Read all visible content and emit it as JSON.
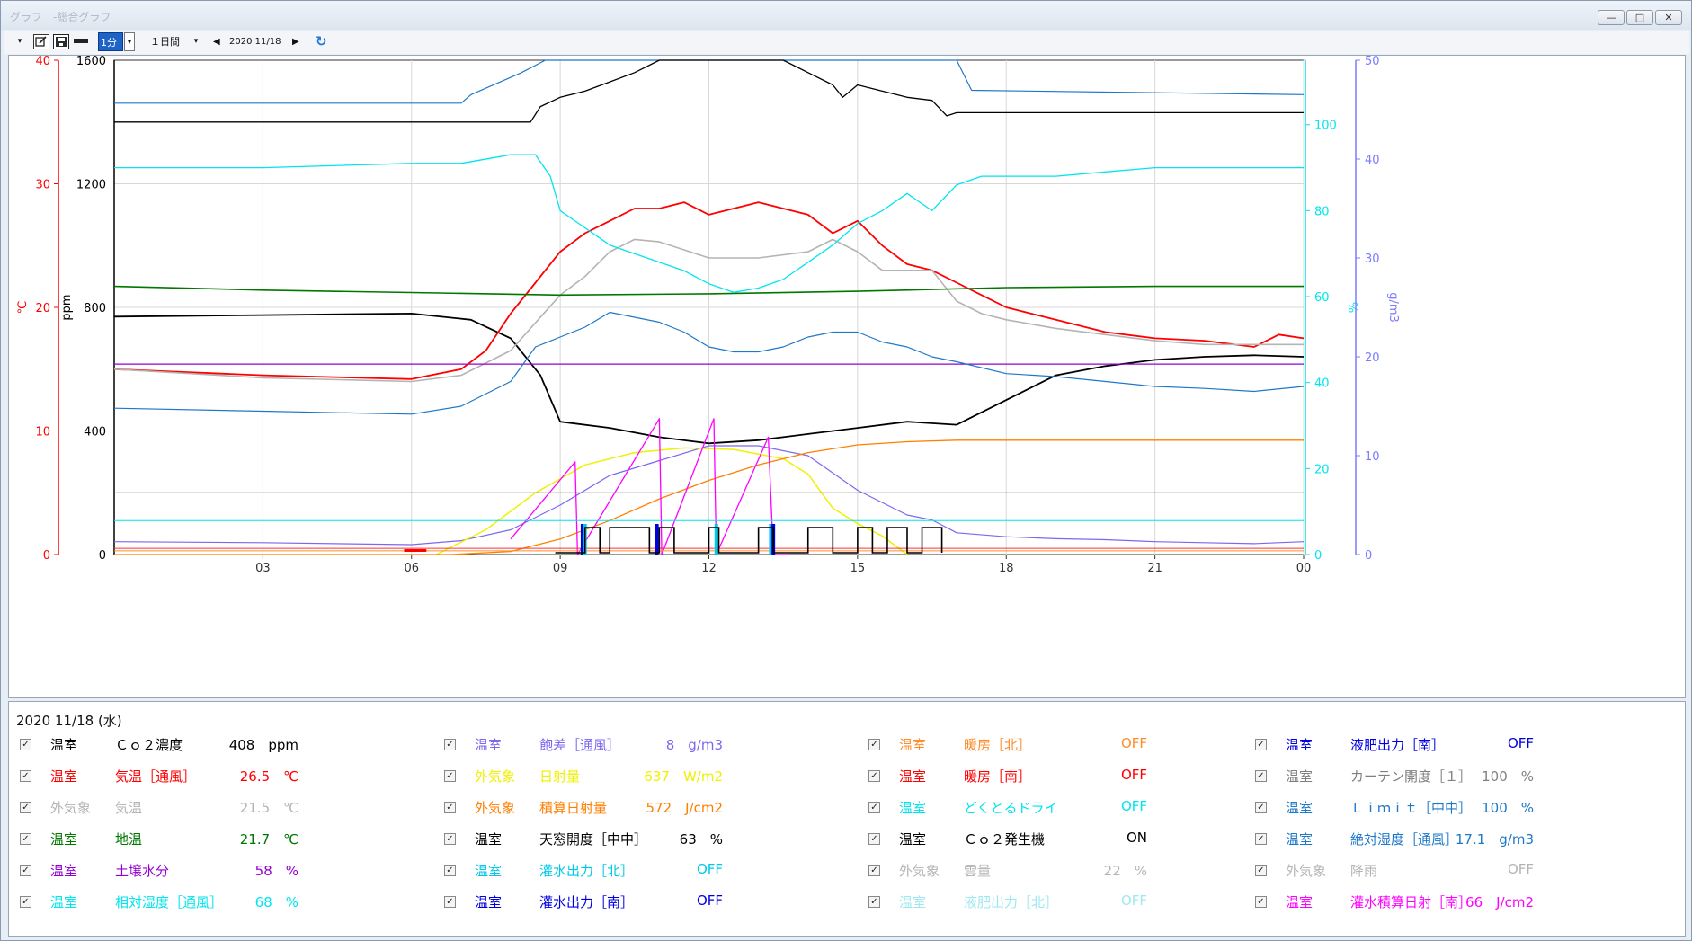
{
  "window": {
    "title": "グラフ　-総合グラフ",
    "min_label": "—",
    "max_label": "□",
    "close_label": "✕"
  },
  "toolbar": {
    "interval_value": "1分",
    "span_value": "１日間",
    "date_label": "2020 11/18",
    "prev_label": "◀",
    "next_label": "▶",
    "refresh_label": "↻"
  },
  "legend": {
    "date_label": "2020 11/18 (水)",
    "items": [
      {
        "group": "温室",
        "name": "Ｃｏ２濃度",
        "value": "408　ppm",
        "color": "#000000"
      },
      {
        "group": "温室",
        "name": "気温［通風］",
        "value": "26.5　℃",
        "color": "#ff0000"
      },
      {
        "group": "外気象",
        "name": "気温",
        "value": "21.5　℃",
        "color": "#b4b4b4"
      },
      {
        "group": "温室",
        "name": "地温",
        "value": "21.7　℃",
        "color": "#007800"
      },
      {
        "group": "温室",
        "name": "土壌水分",
        "value": "58　%",
        "color": "#9400d3"
      },
      {
        "group": "温室",
        "name": "相対湿度［通風］",
        "value": "68　%",
        "color": "#00e5ee"
      },
      {
        "group": "温室",
        "name": "飽差［通風］",
        "value": "8　g/m3",
        "color": "#7b68ee"
      },
      {
        "group": "外気象",
        "name": "日射量",
        "value": "637　W/m2",
        "color": "#f0f000"
      },
      {
        "group": "外気象",
        "name": "積算日射量",
        "value": "572　J/cm2",
        "color": "#ff7f00"
      },
      {
        "group": "温室",
        "name": "天窓開度［中中］",
        "value": "63　%",
        "color": "#000000"
      },
      {
        "group": "温室",
        "name": "灌水出力［北］",
        "value": "OFF",
        "color": "#00c8e8"
      },
      {
        "group": "温室",
        "name": "灌水出力［南］",
        "value": "OFF",
        "color": "#0000e0"
      },
      {
        "group": "温室",
        "name": "暖房［北］",
        "value": "OFF",
        "color": "#ff8c28"
      },
      {
        "group": "温室",
        "name": "暖房［南］",
        "value": "OFF",
        "color": "#ff0000"
      },
      {
        "group": "温室",
        "name": "どくとるドライ",
        "value": "OFF",
        "color": "#00e5ee"
      },
      {
        "group": "温室",
        "name": "Ｃｏ２発生機",
        "value": "ON",
        "color": "#000000"
      },
      {
        "group": "外気象",
        "name": "雲量",
        "value": "22　%",
        "color": "#b4b4b4"
      },
      {
        "group": "温室",
        "name": "液肥出力［北］",
        "value": "OFF",
        "color": "#a0e8f0"
      },
      {
        "group": "温室",
        "name": "液肥出力［南］",
        "value": "OFF",
        "color": "#0000e0"
      },
      {
        "group": "温室",
        "name": "カーテン開度［１］",
        "value": "100　%",
        "color": "#808080"
      },
      {
        "group": "温室",
        "name": "Ｌｉｍｉｔ［中中］",
        "value": "100　%",
        "color": "#1e78c8"
      },
      {
        "group": "温室",
        "name": "絶対湿度［通風］",
        "value": "17.1　g/m3",
        "color": "#1e78c8"
      },
      {
        "group": "外気象",
        "name": "降雨",
        "value": "OFF",
        "color": "#b4b4b4"
      },
      {
        "group": "温室",
        "name": "灌水積算日射［南］",
        "value": "66　J/cm2",
        "color": "#ff00ff"
      }
    ]
  },
  "chart_data": {
    "type": "line",
    "x_ticks": [
      "03",
      "06",
      "09",
      "12",
      "15",
      "18",
      "21",
      "00"
    ],
    "xlim": [
      0,
      24
    ],
    "axes": {
      "temp": {
        "label": "℃",
        "ylim": [
          0,
          40
        ],
        "ticks": [
          "0",
          "10",
          "20",
          "30",
          "40"
        ],
        "color": "#ff0000"
      },
      "co2": {
        "label": "ppm",
        "ylim": [
          0,
          1600
        ],
        "ticks": [
          "0",
          "400",
          "800",
          "1200",
          "1600"
        ],
        "color": "#000000"
      },
      "rh": {
        "label": "%",
        "ylim": [
          0,
          115
        ],
        "ticks": [
          "0",
          "20",
          "40",
          "60",
          "80",
          "100"
        ],
        "color": "#00e5ee"
      },
      "abs": {
        "label": "g/m3",
        "ylim": [
          0,
          50
        ],
        "ticks": [
          "0",
          "10",
          "20",
          "30",
          "40",
          "50"
        ],
        "color": "#7b7bff"
      }
    },
    "series": [
      {
        "name": "Ｃｏ２濃度",
        "axis": "co2",
        "color": "#000000",
        "width": 1.8,
        "x": [
          0,
          3,
          6,
          7.2,
          8.0,
          8.6,
          9.0,
          10.0,
          11.0,
          12.0,
          13.0,
          14.0,
          15.0,
          16.0,
          17.0,
          18.0,
          19.0,
          20.0,
          21.0,
          22.0,
          23.0,
          24.0
        ],
        "y": [
          770,
          775,
          780,
          760,
          700,
          580,
          430,
          410,
          380,
          360,
          370,
          390,
          410,
          430,
          420,
          500,
          580,
          610,
          630,
          640,
          645,
          640
        ]
      },
      {
        "name": "気温［通風］",
        "axis": "temp",
        "color": "#ff0000",
        "width": 1.8,
        "x": [
          0,
          3,
          6,
          7.0,
          7.5,
          8.0,
          8.5,
          9.0,
          9.5,
          10.0,
          10.5,
          11.0,
          11.5,
          12.0,
          12.5,
          13.0,
          13.5,
          14.0,
          14.5,
          15.0,
          15.5,
          16.0,
          16.5,
          17.0,
          17.5,
          18.0,
          18.5,
          19.0,
          20.0,
          21.0,
          22.0,
          23.0,
          23.5,
          24.0
        ],
        "y": [
          15.0,
          14.5,
          14.2,
          15.0,
          16.5,
          19.5,
          22.0,
          24.5,
          26.0,
          27.0,
          28.0,
          28.0,
          28.5,
          27.5,
          28.0,
          28.5,
          28.0,
          27.5,
          26.0,
          27.0,
          25.0,
          23.5,
          23.0,
          22.0,
          21.0,
          20.0,
          19.5,
          19.0,
          18.0,
          17.5,
          17.3,
          16.8,
          17.8,
          17.5
        ]
      },
      {
        "name": "気温",
        "axis": "temp",
        "color": "#b4b4b4",
        "width": 1.6,
        "x": [
          0,
          3,
          6,
          7.0,
          8.0,
          9.0,
          9.5,
          10.0,
          10.5,
          11.0,
          12.0,
          13.0,
          14.0,
          14.5,
          15.0,
          15.5,
          16.0,
          16.5,
          17.0,
          17.5,
          18.0,
          19.0,
          20.0,
          21.0,
          22.0,
          23.0,
          24.0
        ],
        "y": [
          15.0,
          14.3,
          14.0,
          14.5,
          16.5,
          21.0,
          22.5,
          24.5,
          25.5,
          25.3,
          24.0,
          24.0,
          24.5,
          25.5,
          24.5,
          23.0,
          23.0,
          23.0,
          20.5,
          19.5,
          19.0,
          18.3,
          17.8,
          17.3,
          17.0,
          17.0,
          17.0
        ]
      },
      {
        "name": "地温",
        "axis": "temp",
        "color": "#007800",
        "width": 1.6,
        "x": [
          0,
          3,
          6,
          9,
          12,
          15,
          18,
          21,
          24
        ],
        "y": [
          21.7,
          21.4,
          21.2,
          21.0,
          21.1,
          21.3,
          21.6,
          21.7,
          21.7
        ]
      },
      {
        "name": "土壌水分",
        "axis": "rh",
        "color": "#9400d3",
        "width": 1.2,
        "x": [
          0,
          24
        ],
        "y": [
          44.3,
          44.3
        ]
      },
      {
        "name": "相対湿度［通風］",
        "axis": "rh",
        "color": "#00e5ee",
        "width": 1.3,
        "x": [
          0,
          3,
          6,
          7,
          8,
          8.5,
          8.8,
          9.0,
          9.5,
          10.0,
          10.5,
          11.0,
          11.5,
          12.0,
          12.5,
          13.0,
          13.5,
          14.0,
          14.5,
          15.0,
          15.5,
          16.0,
          16.5,
          17.0,
          17.5,
          18.0,
          19.0,
          20.0,
          21.0,
          22.0,
          23.0,
          24.0
        ],
        "y": [
          90,
          90,
          91,
          91,
          93,
          93,
          88,
          80,
          76,
          72,
          70,
          68,
          66,
          63,
          61,
          62,
          64,
          68,
          72,
          77,
          80,
          84,
          80,
          86,
          88,
          88,
          88,
          89,
          90,
          90,
          90,
          90
        ]
      },
      {
        "name": "飽差［通風］",
        "axis": "abs",
        "color": "#7b68ee",
        "width": 1.2,
        "x": [
          0,
          3,
          6,
          7.0,
          8.0,
          9.0,
          10.0,
          11.0,
          12.0,
          13.0,
          14.0,
          15.0,
          16.0,
          16.5,
          17.0,
          18.0,
          19.0,
          20.0,
          21.0,
          22.0,
          23.0,
          24.0
        ],
        "y": [
          1.3,
          1.2,
          1.0,
          1.4,
          2.5,
          5.0,
          8.0,
          9.5,
          11.0,
          11.0,
          10.0,
          6.5,
          4.0,
          3.5,
          2.2,
          1.8,
          1.6,
          1.5,
          1.3,
          1.2,
          1.1,
          1.3
        ]
      },
      {
        "name": "日射量",
        "axis": "co2",
        "color": "#f0f000",
        "width": 1.5,
        "x": [
          6.5,
          7.5,
          8.5,
          9.5,
          10.5,
          11.5,
          12.5,
          13.5,
          14.0,
          14.5,
          15.0,
          15.5,
          16.0
        ],
        "y": [
          0,
          80,
          200,
          290,
          330,
          345,
          340,
          310,
          260,
          150,
          100,
          60,
          0
        ]
      },
      {
        "name": "積算日射量",
        "axis": "co2",
        "color": "#ff7f00",
        "width": 1.3,
        "x": [
          0,
          6.8,
          8.0,
          9.0,
          10.0,
          11.0,
          12.0,
          13.0,
          14.0,
          15.0,
          16.0,
          17.0,
          18.0,
          24.0
        ],
        "y": [
          0,
          0,
          10,
          50,
          110,
          180,
          240,
          290,
          330,
          355,
          365,
          370,
          370,
          370
        ]
      },
      {
        "name": "絶対湿度［通風］",
        "axis": "abs",
        "color": "#1e78c8",
        "width": 1.2,
        "x": [
          0,
          3,
          6,
          7.0,
          8.0,
          8.5,
          9.0,
          9.5,
          10.0,
          10.5,
          11.0,
          11.5,
          12.0,
          12.5,
          13.0,
          13.5,
          14.0,
          14.5,
          15.0,
          15.5,
          16.0,
          16.5,
          17.0,
          18.0,
          19.0,
          20.0,
          21.0,
          22.0,
          23.0,
          24.0
        ],
        "y": [
          14.8,
          14.5,
          14.2,
          15.0,
          17.5,
          21.0,
          22.0,
          23.0,
          24.5,
          24.0,
          23.5,
          22.5,
          21.0,
          20.5,
          20.5,
          21.0,
          22.0,
          22.5,
          22.5,
          21.5,
          21.0,
          20.0,
          19.5,
          18.3,
          18.0,
          17.5,
          17.0,
          16.8,
          16.5,
          17.0
        ]
      },
      {
        "name": "Ｌｉｍｉｔ［中中］",
        "axis": "rh",
        "color": "#1e78c8",
        "width": 1.2,
        "x": [
          0,
          7,
          7.2,
          8.2,
          8.7,
          10.5,
          15.0,
          17.0,
          17.3,
          24.0
        ],
        "y": [
          105,
          105,
          107,
          112,
          115,
          115,
          115,
          115,
          108,
          107
        ]
      },
      {
        "name": "天窓開度［中中］",
        "axis": "co2",
        "color": "#000000",
        "width": 1.3,
        "x": [
          0,
          8.4,
          8.6,
          9.0,
          9.5,
          10.0,
          10.5,
          11.0,
          11.5,
          12.0,
          12.5,
          13.0,
          13.5,
          14.0,
          14.5,
          14.7,
          15.0,
          15.5,
          16.0,
          16.5,
          16.8,
          17.0,
          24.0
        ],
        "y": [
          1400,
          1400,
          1450,
          1480,
          1500,
          1530,
          1560,
          1600,
          1600,
          1600,
          1600,
          1600,
          1600,
          1560,
          1520,
          1480,
          1520,
          1500,
          1480,
          1470,
          1420,
          1430,
          1430
        ]
      },
      {
        "name": "灌水積算日射［南］",
        "axis": "co2",
        "color": "#ff00ff",
        "width": 1.3,
        "x": [
          8.0,
          9.3,
          9.35,
          11.0,
          11.05,
          12.1,
          12.15,
          13.2,
          13.3,
          13.6
        ],
        "y": [
          50,
          300,
          0,
          440,
          0,
          440,
          0,
          380,
          0,
          0
        ]
      },
      {
        "name": "カーテン開度［１］",
        "axis": "co2",
        "color": "#808080",
        "width": 1.0,
        "x": [
          0,
          24
        ],
        "y": [
          200,
          200
        ]
      },
      {
        "name": "どくとるドライ",
        "axis": "co2",
        "color": "#00e5ee",
        "width": 1.0,
        "x": [
          0,
          24
        ],
        "y": [
          110,
          110
        ]
      },
      {
        "name": "暖房［南］",
        "axis": "co2",
        "color": "#ff3030",
        "width": 1.0,
        "x": [
          0,
          24
        ],
        "y": [
          20,
          20
        ]
      },
      {
        "name": "暖房［北］",
        "axis": "co2",
        "color": "#ff8c28",
        "width": 1.0,
        "x": [
          0,
          24
        ],
        "y": [
          12,
          12
        ]
      }
    ]
  }
}
